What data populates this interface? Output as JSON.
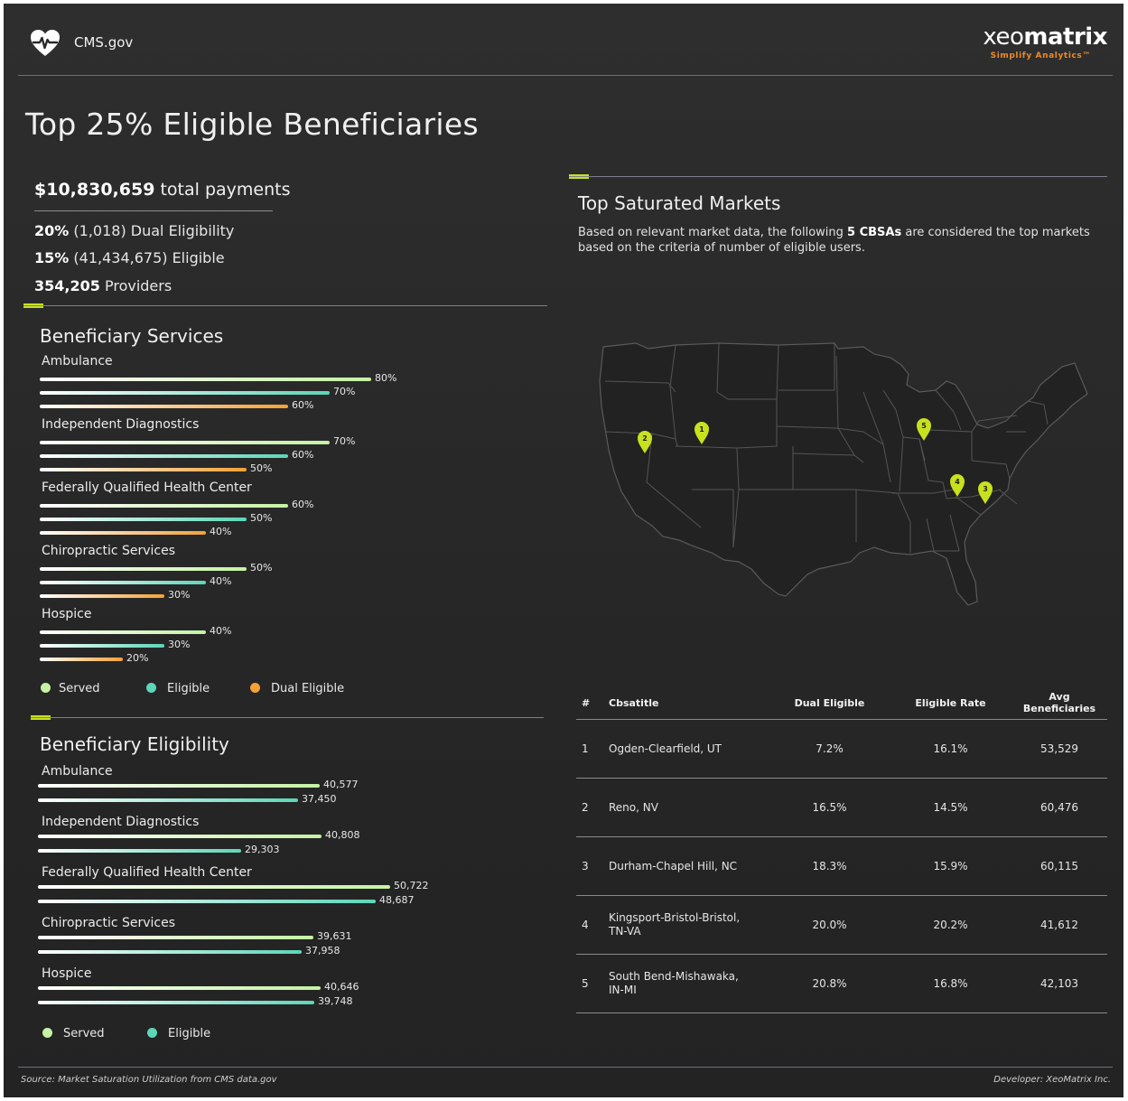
{
  "header": {
    "cms_label": "CMS.gov",
    "brand_xeo": "xeo",
    "brand_matrix": "matrix",
    "brand_tagline": "Simplify Analytics™"
  },
  "page_title": "Top 25% Eligible Beneficiaries",
  "kpis": {
    "total_payments_value": "$10,830,659",
    "total_payments_label": "total payments",
    "dual_pct": "20%",
    "dual_rest": "(1,018) Dual Eligibility",
    "elig_pct": "15%",
    "elig_rest": "(41,434,675) Eligible",
    "providers_value": "354,205",
    "providers_label": "Providers"
  },
  "services_title": "Beneficiary Services",
  "eligibility_title": "Beneficiary Eligibility",
  "markets": {
    "title": "Top Saturated Markets",
    "desc_part1": "Based on relevant market data, the following ",
    "desc_bold": "5 CBSAs",
    "desc_part2": " are considered the top markets based on the criteria of number of eligible users."
  },
  "legend_services": [
    "Served",
    "Eligible",
    "Dual Eligible"
  ],
  "legend_eligibility": [
    "Served",
    "Eligible"
  ],
  "colors": {
    "served": "#c5f2a4",
    "eligible": "#5dd6b8",
    "dual": "#f4a136",
    "accent": "#c8e11e",
    "pin": "#c8e11e"
  },
  "chart_data": [
    {
      "type": "bar",
      "title": "Beneficiary Services",
      "orientation": "horizontal",
      "categories": [
        "Ambulance",
        "Independent Diagnostics",
        "Federally Qualified Health Center",
        "Chiropractic Services",
        "Hospice"
      ],
      "series": [
        {
          "name": "Served",
          "values": [
            80,
            70,
            60,
            50,
            40
          ]
        },
        {
          "name": "Eligible",
          "values": [
            70,
            60,
            50,
            40,
            30
          ]
        },
        {
          "name": "Dual Eligible",
          "values": [
            60,
            50,
            40,
            30,
            20
          ]
        }
      ],
      "value_labels": [
        [
          "80%",
          "70%",
          "60%",
          "50%",
          "40%"
        ],
        [
          "70%",
          "60%",
          "50%",
          "40%",
          "30%"
        ],
        [
          "60%",
          "50%",
          "40%",
          "30%",
          "20%"
        ]
      ],
      "xlim": [
        0,
        100
      ],
      "legend": "bottom"
    },
    {
      "type": "bar",
      "title": "Beneficiary Eligibility",
      "orientation": "horizontal",
      "categories": [
        "Ambulance",
        "Independent Diagnostics",
        "Federally Qualified Health Center",
        "Chiropractic Services",
        "Hospice"
      ],
      "series": [
        {
          "name": "Served",
          "values": [
            40577,
            40808,
            50722,
            39631,
            40646
          ]
        },
        {
          "name": "Eligible",
          "values": [
            37450,
            29303,
            48687,
            37958,
            39748
          ]
        }
      ],
      "value_labels": [
        [
          "40,577",
          "40,808",
          "50,722",
          "39,631",
          "40,646"
        ],
        [
          "37,450",
          "29,303",
          "48,687",
          "37,958",
          "39,748"
        ]
      ],
      "xlim": [
        0,
        50722
      ],
      "legend": "bottom"
    },
    {
      "type": "table",
      "columns": [
        "#",
        "Cbsatitle",
        "Dual Eligible",
        "Eligible Rate",
        "Avg Beneficiaries"
      ],
      "rows": [
        {
          "rank": "1",
          "cbsa": [
            "Ogden-Clearfield, UT"
          ],
          "dual": "7.2%",
          "rate": "16.1%",
          "avg": "53,529"
        },
        {
          "rank": "2",
          "cbsa": [
            "Reno, NV"
          ],
          "dual": "16.5%",
          "rate": "14.5%",
          "avg": "60,476"
        },
        {
          "rank": "3",
          "cbsa": [
            "Durham-Chapel Hill, NC"
          ],
          "dual": "18.3%",
          "rate": "15.9%",
          "avg": "60,115"
        },
        {
          "rank": "4",
          "cbsa": [
            "Kingsport-Bristol-Bristol,",
            "TN-VA"
          ],
          "dual": "20.0%",
          "rate": "20.2%",
          "avg": "41,612"
        },
        {
          "rank": "5",
          "cbsa": [
            "South Bend-Mishawaka,",
            "IN-MI"
          ],
          "dual": "20.8%",
          "rate": "16.8%",
          "avg": "42,103"
        }
      ]
    }
  ],
  "map_pins": [
    "1",
    "2",
    "3",
    "4",
    "5"
  ],
  "footer": {
    "source": "Source: Market Saturation Utilization from CMS data.gov",
    "developer": "Developer: XeoMatrix Inc."
  }
}
